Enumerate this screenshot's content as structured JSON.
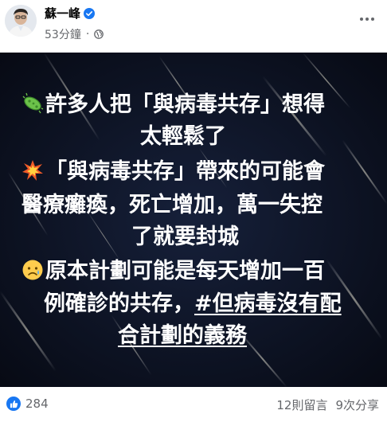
{
  "post": {
    "author": "蘇一峰",
    "time": "53分鐘",
    "separator": "·",
    "verified_icon": "verified-badge-icon",
    "privacy_icon": "globe-icon"
  },
  "image_text": {
    "line1": "許多人把「與病毒共存」想得",
    "line2": "太輕鬆了",
    "line3": "「與病毒共存」帶來的可能會",
    "line4": "醫療癱瘓，死亡增加，萬一失控",
    "line5": "了就要封城",
    "line6": "原本計劃可能是每天增加一百",
    "line7a": "例確診的共存，",
    "line7b": "#但病毒沒有配",
    "line8": "合計劃的義務"
  },
  "footer": {
    "reaction_count": "284",
    "comments": "12則留言",
    "shares": "9次分享"
  },
  "colors": {
    "accent": "#1877f2",
    "image_bg": "#0a0f1e",
    "secondary_text": "#65676b"
  }
}
